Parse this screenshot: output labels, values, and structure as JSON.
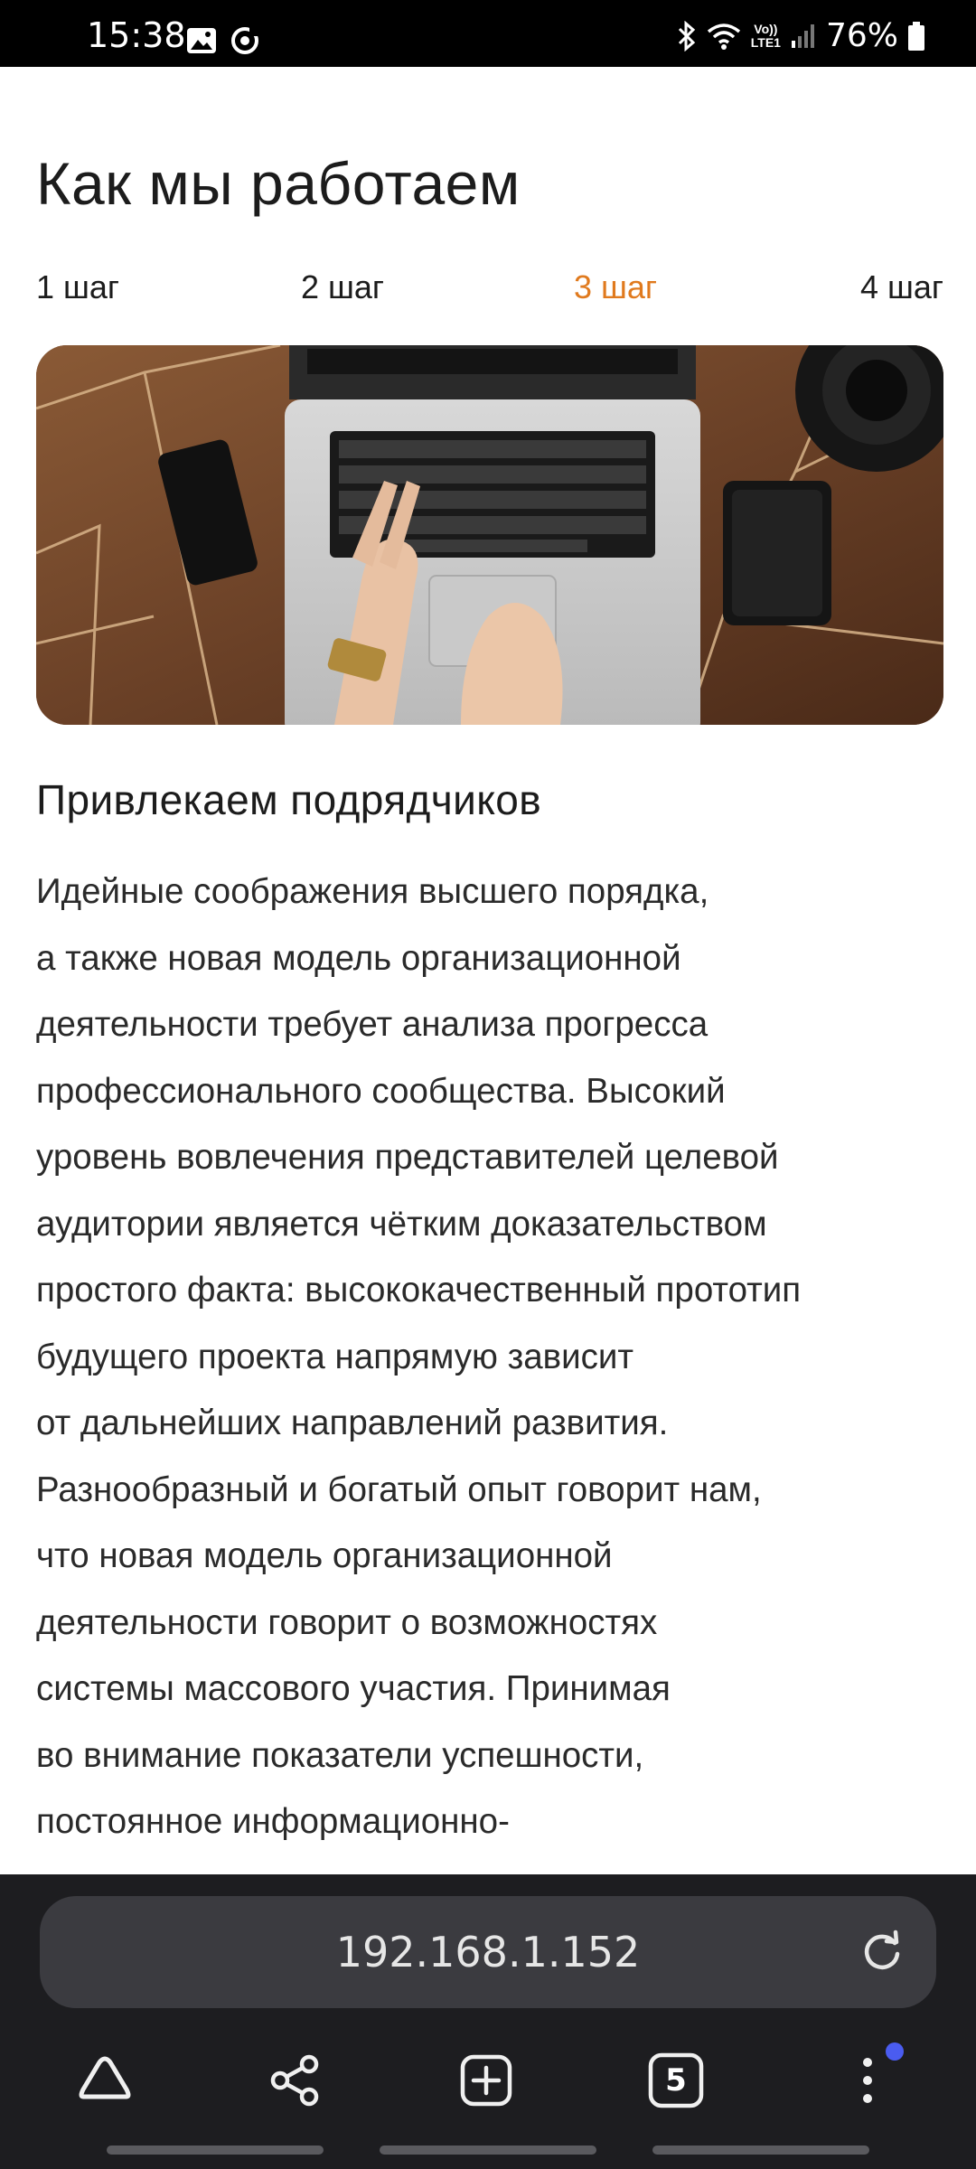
{
  "status_bar": {
    "time": "15:38",
    "network": "LTE1",
    "volte": "Vo))",
    "battery": "76%",
    "icons": [
      "gallery-icon",
      "sync-icon",
      "bluetooth-icon",
      "wifi-icon",
      "signal-icon",
      "battery-icon"
    ]
  },
  "page": {
    "title": "Как мы работаем",
    "steps": [
      {
        "label": "1 шаг",
        "active": false
      },
      {
        "label": "2 шаг",
        "active": false
      },
      {
        "label": "3 шаг",
        "active": true
      },
      {
        "label": "4 шаг",
        "active": false
      }
    ],
    "accent_color": "#e07a1e",
    "section_title": "Привлекаем подрядчиков",
    "body_lines": [
      "Идейные соображения высшего порядка,",
      "а также новая модель организационной",
      "деятельности требует анализа прогресса",
      "профессионального сообщества. Высокий",
      "уровень вовлечения представителей целевой",
      "аудитории является чётким доказательством",
      "простого факта: высококачественный прототип",
      "будущего проекта напрямую зависит",
      "от дальнейших направлений развития.",
      "Разнообразный и богатый опыт говорит нам,",
      "что новая модель организационной",
      "деятельности говорит о возможностях",
      "системы массового участия. Принимая",
      "во внимание показатели успешности,",
      "постоянное информационно-"
    ]
  },
  "browser": {
    "url": "192.168.1.152",
    "tab_count": "5",
    "notify_color": "#4a5cf0"
  }
}
